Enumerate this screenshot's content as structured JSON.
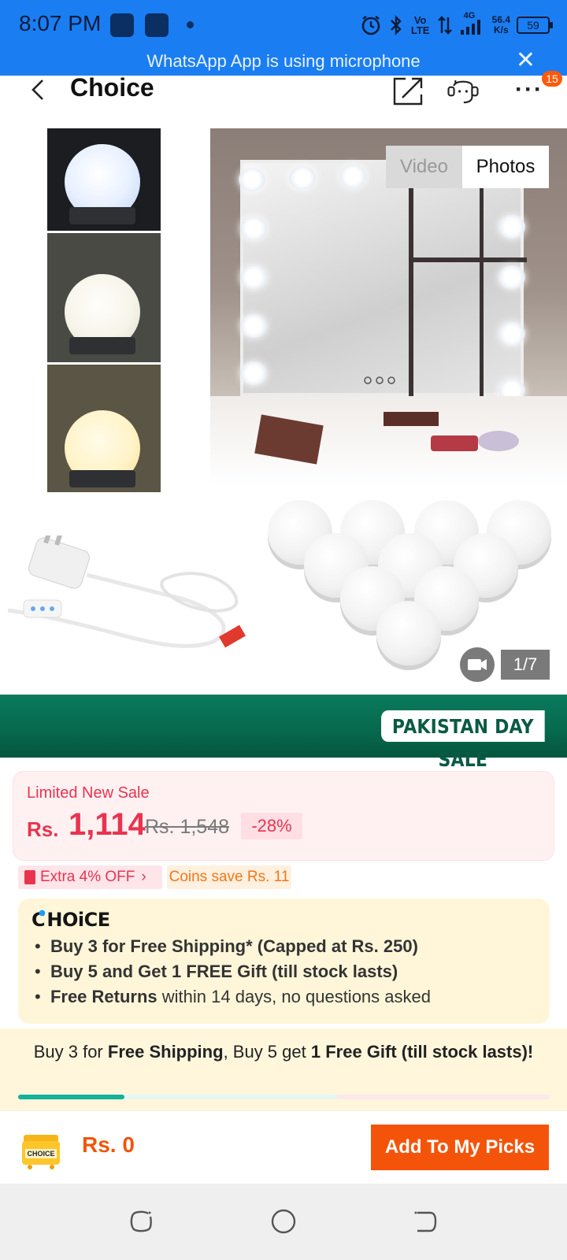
{
  "status_bar": {
    "time": "8:07 PM",
    "network_rate": "56.4",
    "network_rate_unit": "K/s",
    "volte": "Vo LTE",
    "network_type": "4G",
    "battery": "59",
    "colors": {
      "background": "#1a7ef2"
    }
  },
  "mic_banner": {
    "text": "WhatsApp App is using microphone"
  },
  "header": {
    "title": "Choice",
    "cart_badge": "15",
    "icons": [
      "back-icon",
      "share-icon",
      "support-icon",
      "more-icon"
    ]
  },
  "gallery": {
    "toggle": {
      "video_label": "Video",
      "photos_label": "Photos",
      "selected": "Photos"
    },
    "counter": "1/7"
  },
  "sale_banner": {
    "label": "PAKISTAN DAY SALE",
    "color": "#0a7a5d"
  },
  "price": {
    "badge_label": "Limited New Sale",
    "currency": "Rs.",
    "current": "1,114",
    "original": "Rs. 1,548",
    "discount": "-28%",
    "accent": "#e8344e"
  },
  "tags": {
    "extra_off": "Extra 4% OFF",
    "coins": "Coins save Rs. 11"
  },
  "choice": {
    "logo": "CHOiCE",
    "line1_bold": "Buy 3 for  Free Shipping* (Capped at Rs. 250)",
    "line2_bold": "Buy 5 and Get 1 FREE Gift (till stock lasts)",
    "line3_bold": "Free Returns",
    "line3_rest": " within 14 days, no questions asked"
  },
  "promo": {
    "part1": "Buy 3 for ",
    "part1_bold": "Free Shipping",
    "part2": ", Buy 5 get ",
    "part2_bold": "1 Free Gift (till stock lasts)!",
    "progress_fraction": 0.2
  },
  "bottom_bar": {
    "cart_label": "CHOICE",
    "total": "Rs. 0",
    "add_button": "Add To My Picks",
    "button_color": "#f4540a"
  },
  "nav_bar": {
    "icons": [
      "recents-icon",
      "home-icon",
      "back-nav-icon"
    ]
  }
}
